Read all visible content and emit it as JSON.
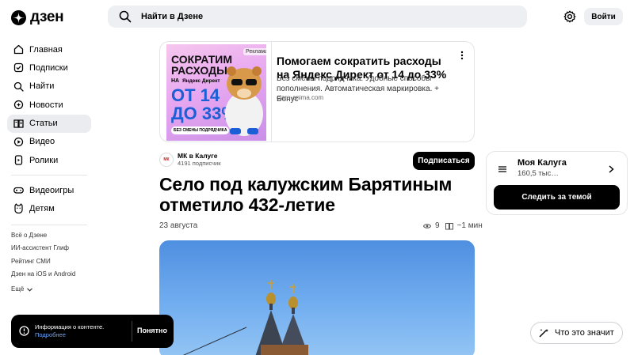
{
  "header": {
    "logo_text": "дзен",
    "search_placeholder": "Найти в Дзене",
    "login_label": "Войти"
  },
  "sidebar": {
    "items": [
      {
        "label": "Главная",
        "icon": "home-icon"
      },
      {
        "label": "Подписки",
        "icon": "subscriptions-icon"
      },
      {
        "label": "Найти",
        "icon": "search-icon"
      },
      {
        "label": "Новости",
        "icon": "news-icon"
      },
      {
        "label": "Статьи",
        "icon": "articles-icon",
        "active": true
      },
      {
        "label": "Видео",
        "icon": "video-icon"
      },
      {
        "label": "Ролики",
        "icon": "shorts-icon"
      }
    ],
    "items2": [
      {
        "label": "Видеоигры",
        "icon": "gamepad-icon"
      },
      {
        "label": "Детям",
        "icon": "kids-icon"
      }
    ],
    "footer_links": [
      "Всё о Дзене",
      "ИИ-ассистент Глиф",
      "Рейтинг СМИ",
      "Дзен на iOS и Android"
    ],
    "more_label": "Ещё"
  },
  "ad": {
    "tag": "Реклама",
    "image_text": {
      "line1": "СОКРАТИМ",
      "line2": "РАСХОДЫ",
      "line3": "НА",
      "brand": "Яндекс Директ",
      "line4": "ОТ 14",
      "line5": "ДО 33%",
      "badge": "БЕЗ СМЕНЫ ПОДРЯДЧИКА"
    },
    "title": "Помогаем сократить расходы на Яндекс Директ от 14 до 33%",
    "description": "Без смены подрядчика. Удобные способы пополнения. Автоматическая маркировка. + Бонус",
    "domain": "clara-anima.com"
  },
  "article": {
    "publisher_logo_text": "МК",
    "publisher_name": "МК в Калуге",
    "publisher_subs": "4191 подписчик",
    "subscribe_label": "Подписаться",
    "title": "Село под калужским Барятиным отметило 432-летие",
    "date": "23 августа",
    "views": "9",
    "read_time": "~1 мин"
  },
  "widget": {
    "title": "Моя Калуга",
    "subtitle": "160,5 тыс…",
    "follow_label": "Следить за темой"
  },
  "toast": {
    "text": "Информация о контенте.",
    "link": "Подробнее",
    "button": "Понятно"
  },
  "explain": {
    "label": "Что это значит"
  }
}
